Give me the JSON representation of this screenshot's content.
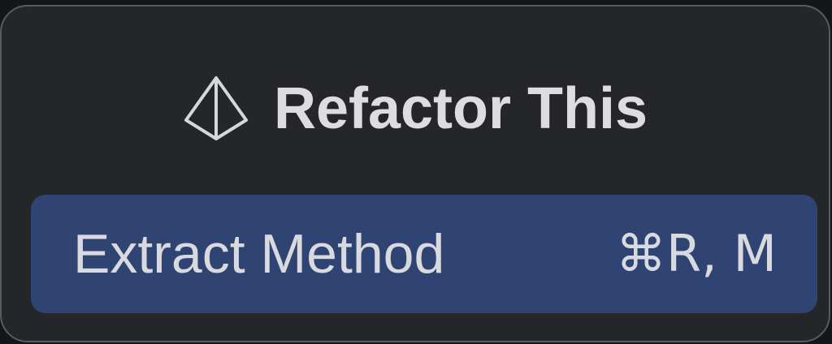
{
  "popup": {
    "title": "Refactor This",
    "title_icon": "prism-icon",
    "items": [
      {
        "label": "Extract Method",
        "shortcut": "⌘R, M",
        "selected": true
      }
    ]
  },
  "colors": {
    "background": "#252629",
    "border": "#5a5b5f",
    "selection": "#2f4472",
    "text": "#dddddf"
  }
}
